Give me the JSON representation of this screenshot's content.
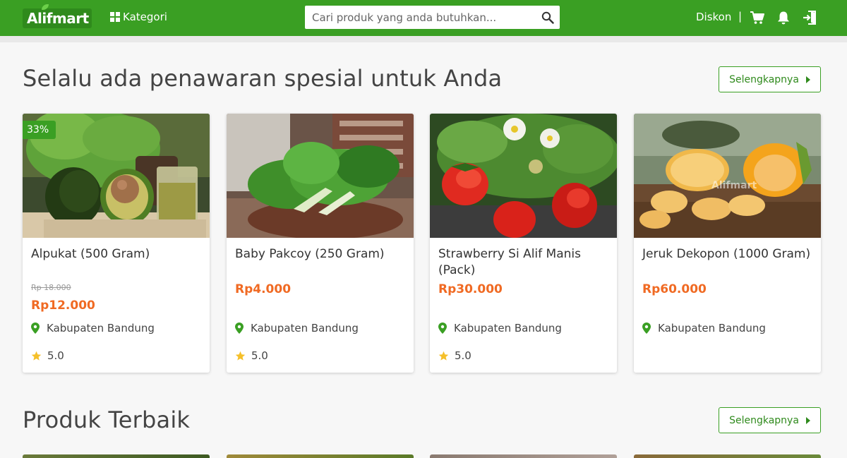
{
  "header": {
    "logo_text": "Alifmart",
    "kategori_label": "Kategori",
    "search_placeholder": "Cari produk yang anda butuhkan...",
    "diskon_label": "Diskon",
    "separator": "|",
    "colors": {
      "brand_green": "#3a9f23",
      "price_orange": "#f06a23"
    }
  },
  "sections": [
    {
      "title": "Selalu ada penawaran spesial untuk Anda",
      "more_label": "Selengkapnya"
    },
    {
      "title": "Produk Terbaik",
      "more_label": "Selengkapnya"
    }
  ],
  "products": [
    {
      "name": "Alpukat (500 Gram)",
      "discount_badge": "33%",
      "old_price": "Rp 18.000",
      "price": "Rp12.000",
      "location": "Kabupaten Bandung",
      "rating": "5.0",
      "image": "avocado-photo"
    },
    {
      "name": "Baby Pakcoy (250 Gram)",
      "price": "Rp4.000",
      "location": "Kabupaten Bandung",
      "rating": "5.0",
      "image": "pakcoy-photo"
    },
    {
      "name": "Strawberry Si Alif Manis (Pack)",
      "price": "Rp30.000",
      "location": "Kabupaten Bandung",
      "rating": "5.0",
      "image": "strawberry-photo"
    },
    {
      "name": "Jeruk Dekopon (1000 Gram)",
      "price": "Rp60.000",
      "location": "Kabupaten Bandung",
      "image": "orange-photo",
      "watermark": "Alifmart"
    }
  ],
  "icons": [
    "grid-icon",
    "search-icon",
    "cart-icon",
    "bell-icon",
    "logout-icon",
    "location-pin-icon",
    "star-icon",
    "chevron-right-icon"
  ]
}
